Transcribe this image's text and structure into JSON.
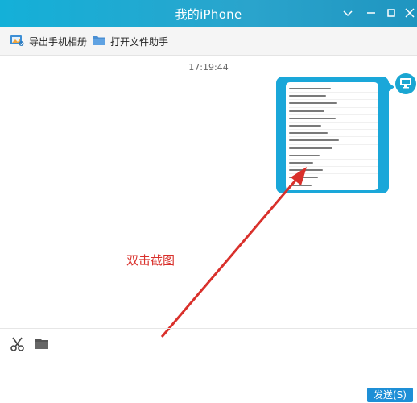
{
  "window": {
    "title": "我的iPhone"
  },
  "toolbar": {
    "export_photos_label": "导出手机相册",
    "open_file_helper_label": "打开文件助手"
  },
  "chat": {
    "timestamp": "17:19:44",
    "annotation": "双击截图"
  },
  "footer": {
    "send_label": "发送(S)"
  },
  "colors": {
    "titlebar": "#1fa0c8",
    "bubble": "#1aa7d9",
    "arrow": "#d9302b",
    "send_button": "#1e8fd6"
  }
}
